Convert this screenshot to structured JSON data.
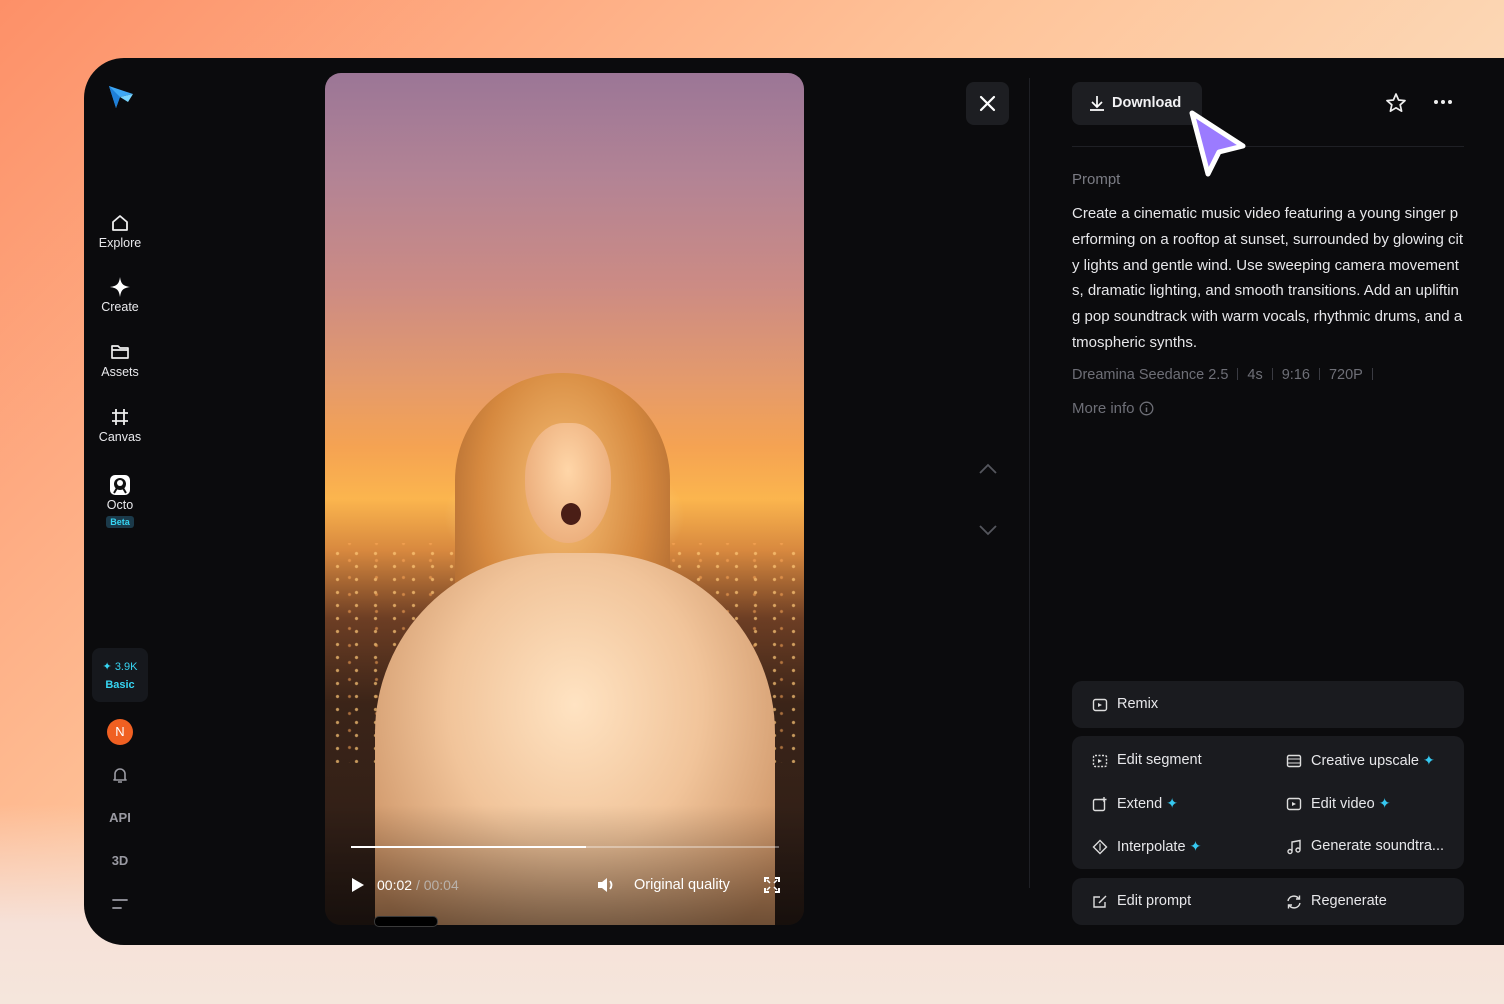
{
  "sidebar": {
    "items": [
      {
        "label": "Explore",
        "icon": "home-icon"
      },
      {
        "label": "Create",
        "icon": "sparkle-icon"
      },
      {
        "label": "Assets",
        "icon": "folder-icon"
      },
      {
        "label": "Canvas",
        "icon": "canvas-grid-icon"
      },
      {
        "label": "Octo",
        "icon": "octo-icon",
        "badge": "Beta"
      }
    ],
    "credits": {
      "amount": "3.9K",
      "plan": "Basic"
    },
    "avatar_initial": "N",
    "api_label": "API",
    "three_d_label": "3D"
  },
  "player": {
    "current_time": "00:02",
    "total_time": "/ 00:04",
    "progress": 0.55,
    "quality": "Original quality"
  },
  "panel": {
    "download_label": "Download",
    "prompt_label": "Prompt",
    "prompt_text": "Create a cinematic music video featuring a young singer performing on a rooftop at sunset, surrounded by glowing city lights and gentle wind. Use sweeping camera movements, dramatic lighting, and smooth transitions. Add an uplifting pop soundtrack with warm vocals, rhythmic drums, and atmospheric synths.",
    "meta": {
      "model": "Dreamina Seedance 2.5",
      "duration": "4s",
      "ratio": "9:16",
      "resolution": "720P"
    },
    "more_info": "More info",
    "actions": {
      "remix": "Remix",
      "edit_segment": "Edit segment",
      "creative_upscale": "Creative upscale",
      "extend": "Extend",
      "edit_video": "Edit video",
      "interpolate": "Interpolate",
      "generate_soundtrack": "Generate soundtra...",
      "edit_prompt": "Edit prompt",
      "regenerate": "Regenerate"
    }
  },
  "colors": {
    "accent": "#36d4f2",
    "avatar": "#f06022",
    "cursor": "#9b7bff"
  }
}
